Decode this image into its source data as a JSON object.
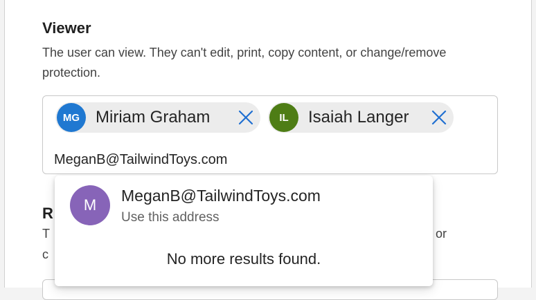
{
  "viewer": {
    "title": "Viewer",
    "description": "The user can view. They can't edit, print, copy content, or change/remove protection."
  },
  "picker": {
    "chips": [
      {
        "initials": "MG",
        "name": "Miriam Graham",
        "color": "#1f78d1"
      },
      {
        "initials": "IL",
        "name": "Isaiah Langer",
        "color": "#4e7d15"
      }
    ],
    "input_value": "MeganB@TailwindToys.com",
    "remove_icon": "close-icon"
  },
  "dropdown": {
    "suggestion": {
      "initial": "M",
      "email": "MeganB@TailwindToys.com",
      "subtitle": "Use this address",
      "color": "#8764b8"
    },
    "no_results": "No more results found."
  },
  "behind": {
    "heading_fragment": "R",
    "line_start": "T",
    "line_end": "or",
    "line2_start": "c"
  },
  "colors": {
    "remove_icon": "#1f6fd1"
  }
}
